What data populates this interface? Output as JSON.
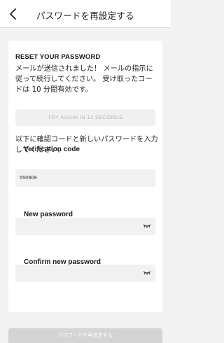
{
  "header": {
    "title": "パスワードを再設定する"
  },
  "card": {
    "heading": "RESET YOUR PASSWORD",
    "notice": "メールが送信されました！ メールの指示に従って続行してください。 受け取ったコードは 10 分間有効です。",
    "retry_label": "TRY AGAIN IN 12 SECONDS",
    "instruction": "以下に確認コードと新しいパスワードを入力してください。",
    "verification": {
      "label": "Verification code",
      "value": "550909"
    },
    "new_password": {
      "label": "New password",
      "value": ""
    },
    "confirm_password": {
      "label": "Confirm new password",
      "value": ""
    }
  },
  "footer": {
    "submit_label": "パスワードを再設定する"
  }
}
